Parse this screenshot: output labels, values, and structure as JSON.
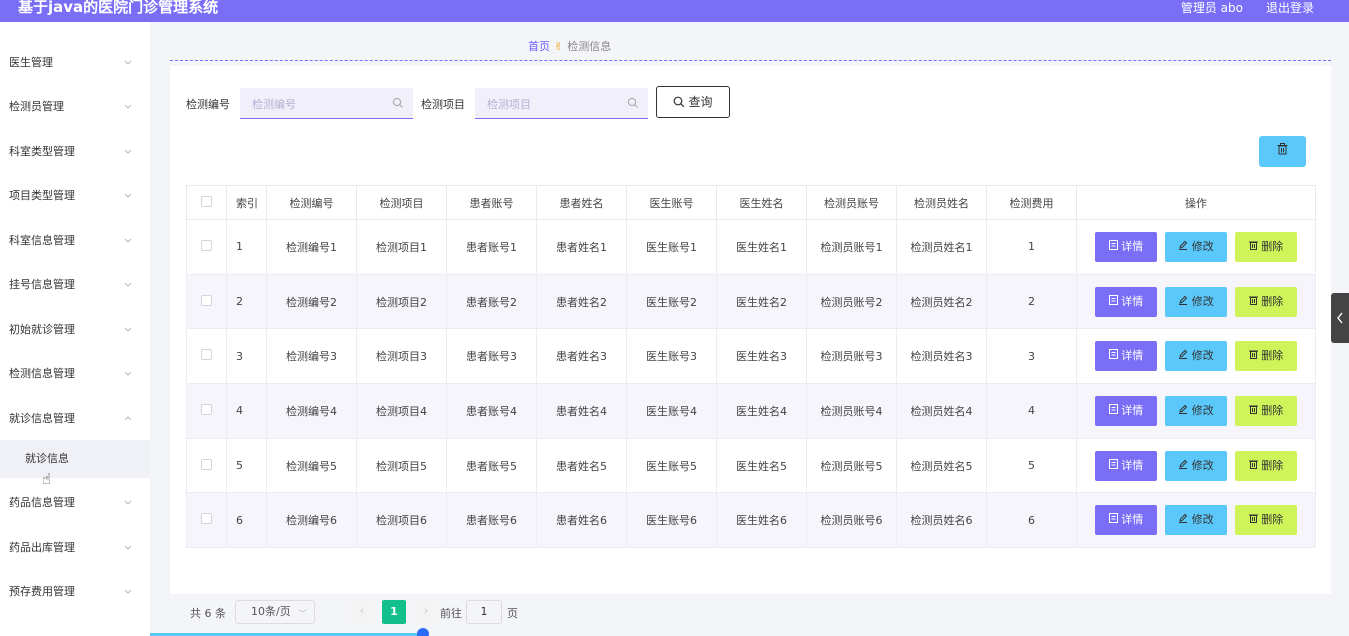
{
  "header": {
    "title": "基于java的医院门诊管理系统",
    "admin": "管理员 abo",
    "logout": "退出登录"
  },
  "sidebar": {
    "items": [
      {
        "label": "医生管理"
      },
      {
        "label": "检测员管理"
      },
      {
        "label": "科室类型管理"
      },
      {
        "label": "项目类型管理"
      },
      {
        "label": "科室信息管理"
      },
      {
        "label": "挂号信息管理"
      },
      {
        "label": "初始就诊管理"
      },
      {
        "label": "检测信息管理"
      },
      {
        "label": "就诊信息管理"
      },
      {
        "label": "就诊信息",
        "sub": true
      },
      {
        "label": "药品信息管理"
      },
      {
        "label": "药品出库管理"
      },
      {
        "label": "预存费用管理"
      }
    ]
  },
  "breadcrumb": {
    "home": "首页",
    "current": "检测信息"
  },
  "search": {
    "code_label": "检测编号",
    "code_placeholder": "检测编号",
    "item_label": "检测项目",
    "item_placeholder": "检测项目",
    "query": "查询"
  },
  "table": {
    "headers": [
      "索引",
      "检测编号",
      "检测项目",
      "患者账号",
      "患者姓名",
      "医生账号",
      "医生姓名",
      "检测员账号",
      "检测员姓名",
      "检测费用",
      "操作"
    ],
    "rows": [
      [
        "1",
        "检测编号1",
        "检测项目1",
        "患者账号1",
        "患者姓名1",
        "医生账号1",
        "医生姓名1",
        "检测员账号1",
        "检测员姓名1",
        "1"
      ],
      [
        "2",
        "检测编号2",
        "检测项目2",
        "患者账号2",
        "患者姓名2",
        "医生账号2",
        "医生姓名2",
        "检测员账号2",
        "检测员姓名2",
        "2"
      ],
      [
        "3",
        "检测编号3",
        "检测项目3",
        "患者账号3",
        "患者姓名3",
        "医生账号3",
        "医生姓名3",
        "检测员账号3",
        "检测员姓名3",
        "3"
      ],
      [
        "4",
        "检测编号4",
        "检测项目4",
        "患者账号4",
        "患者姓名4",
        "医生账号4",
        "医生姓名4",
        "检测员账号4",
        "检测员姓名4",
        "4"
      ],
      [
        "5",
        "检测编号5",
        "检测项目5",
        "患者账号5",
        "患者姓名5",
        "医生账号5",
        "医生姓名5",
        "检测员账号5",
        "检测员姓名5",
        "5"
      ],
      [
        "6",
        "检测编号6",
        "检测项目6",
        "患者账号6",
        "患者姓名6",
        "医生账号6",
        "医生姓名6",
        "检测员账号6",
        "检测员姓名6",
        "6"
      ]
    ],
    "actions": {
      "detail": "详情",
      "edit": "修改",
      "delete": "删除"
    }
  },
  "pager": {
    "total": "共 6 条",
    "size": "10条/页",
    "current": "1",
    "goto": "前往",
    "goto_value": "1",
    "unit": "页"
  },
  "colors": {
    "accent": "#7b6ef6",
    "info": "#5ac8fa",
    "danger": "#cff45a",
    "page": "#13c08b"
  }
}
